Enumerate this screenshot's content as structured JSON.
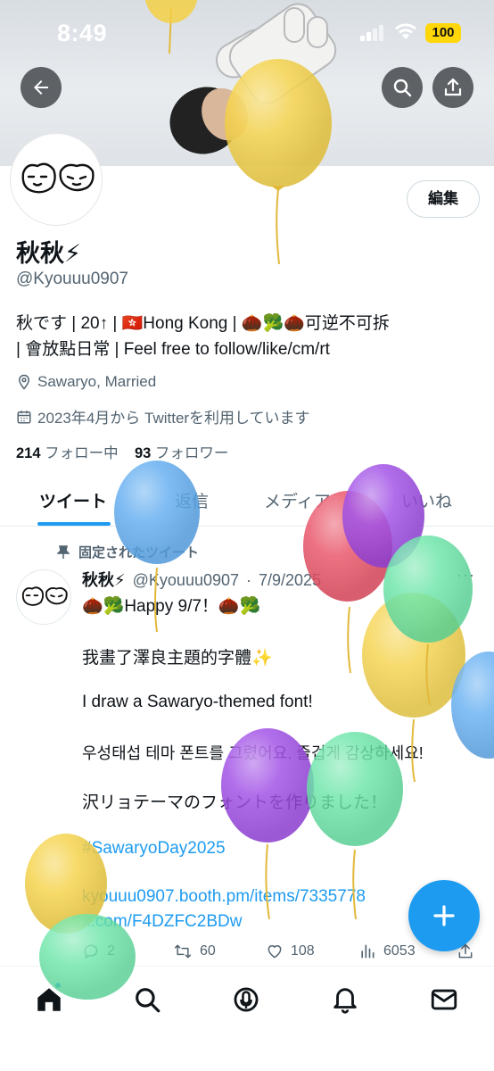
{
  "status_bar": {
    "time": "8:49",
    "battery": "100"
  },
  "header": {
    "back_icon": "arrow-left-icon",
    "search_icon": "search-icon",
    "share_icon": "share-icon"
  },
  "profile": {
    "edit_label": "編集",
    "display_name": "秋秋⚡",
    "handle": "@Kyouuu0907",
    "bio_line1": "秋です | 20↑ | 🇭🇰Hong Kong  | 🌰🥦🌰可逆不可拆",
    "bio_line2": " | 會放點日常 | Feel free to follow/like/cm/rt",
    "location": "Sawaryo, Married",
    "joined": "2023年4月から Twitterを利用しています",
    "following_count": "214",
    "following_label": "フォロー中",
    "followers_count": "93",
    "followers_label": "フォロワー"
  },
  "tabs": [
    {
      "label": "ツイート",
      "active": true
    },
    {
      "label": "返信",
      "active": false
    },
    {
      "label": "メディア",
      "active": false
    },
    {
      "label": "いいね",
      "active": false
    }
  ],
  "pinned_tweet": {
    "pinned_label": "固定されたツイート",
    "name": "秋秋⚡",
    "handle": "@Kyouuu0907",
    "separator": "·",
    "date": "7/9/2025",
    "more": "···",
    "lines": [
      "🌰🥦Happy 9/7！🌰🥦",
      "我畫了澤良主題的字體✨",
      "I draw a Sawaryo-themed font!",
      "우성태섭 테마 폰트를 그렸어요. 즐겁게 감상하세요!",
      "沢リョテーマのフォントを作りました！"
    ],
    "hashtag": "#SawaryoDay2025",
    "link1": "kyouuu0907.booth.pm/items/7335778",
    "link2": "x.com/F4DZFC2BDw",
    "replies": "2",
    "retweets": "60",
    "likes": "108",
    "views": "6053"
  },
  "bottom_nav": {
    "items": [
      "home-icon",
      "search-icon",
      "spaces-icon",
      "bell-icon",
      "mail-icon"
    ],
    "fab_icon": "plus-icon"
  },
  "colors": {
    "accent": "#1d9bf0",
    "text": "#0f1419",
    "muted": "#536471",
    "balloon_yellow": "#f4d03f",
    "balloon_blue": "#5aa9f0",
    "balloon_red": "#e84a5f",
    "balloon_purple": "#9b45e4",
    "balloon_green": "#5fe3a1"
  }
}
